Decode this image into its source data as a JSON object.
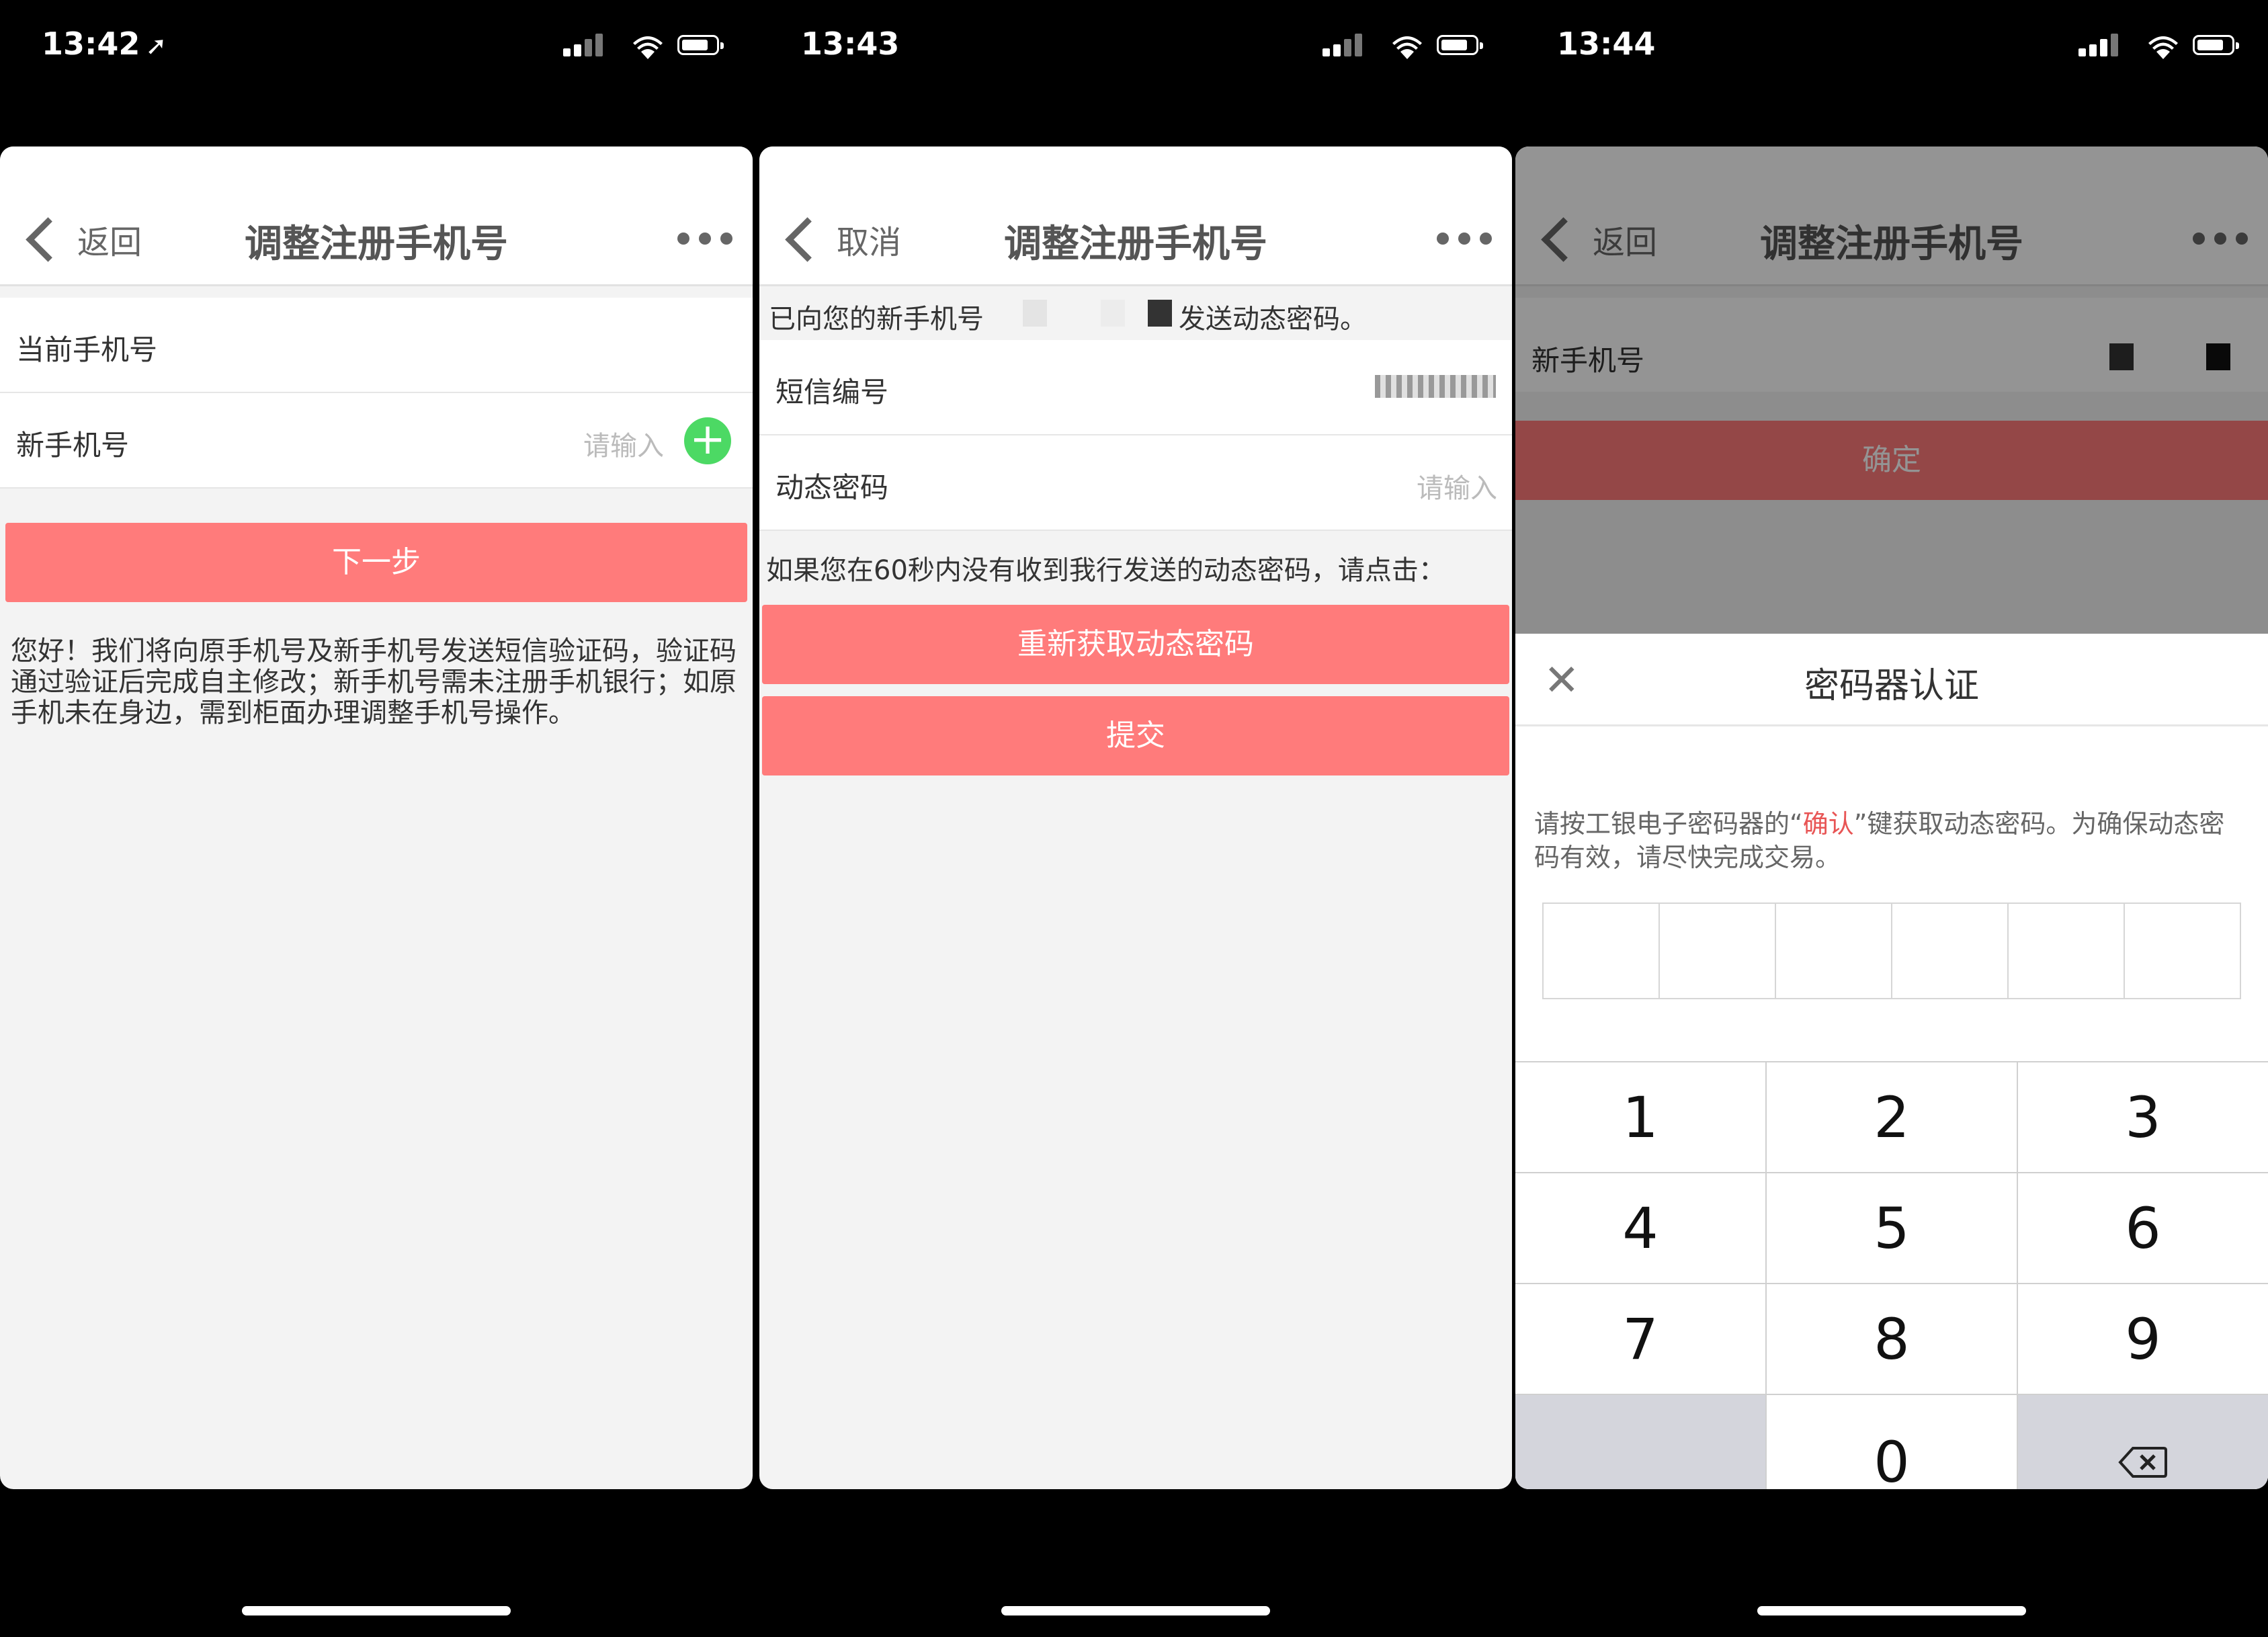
{
  "screens": [
    {
      "time": "13:42",
      "nav": {
        "back": "返回",
        "title": "调整注册手机号"
      },
      "rows": [
        {
          "label": "当前手机号"
        },
        {
          "label": "新手机号",
          "placeholder": "请输入"
        }
      ],
      "button": "下一步",
      "notice": "您好！我们将向原手机号及新手机号发送短信验证码，验证码通过验证后完成自主修改；新手机号需未注册手机银行；如原手机未在身边，需到柜面办理调整手机号操作。"
    },
    {
      "time": "13:43",
      "nav": {
        "back": "取消",
        "title": "调整注册手机号"
      },
      "info_prefix": "已向您的新手机号",
      "info_suffix": "发送动态密码。",
      "rows": [
        {
          "label": "短信编号"
        },
        {
          "label": "动态密码",
          "placeholder": "请输入"
        }
      ],
      "hint": "如果您在60秒内没有收到我行发送的动态密码，请点击：",
      "resend_button": "重新获取动态密码",
      "submit_button": "提交"
    },
    {
      "time": "13:44",
      "nav": {
        "back": "返回",
        "title": "调整注册手机号"
      },
      "rows": [
        {
          "label": "新手机号"
        }
      ],
      "confirm_button": "确定",
      "sheet": {
        "title": "密码器认证",
        "desc_part1": "请按工银电子密码器的“",
        "desc_highlight": "确认",
        "desc_part2": "”键获取动态密码。为确保动态密码有效，请尽快完成交易。",
        "keys": [
          "1",
          "2",
          "3",
          "4",
          "5",
          "6",
          "7",
          "8",
          "9",
          "",
          "0",
          ""
        ]
      }
    }
  ],
  "colors": {
    "accent": "#ff7b7b",
    "plus": "#4cd964",
    "highlight": "#e85555"
  }
}
